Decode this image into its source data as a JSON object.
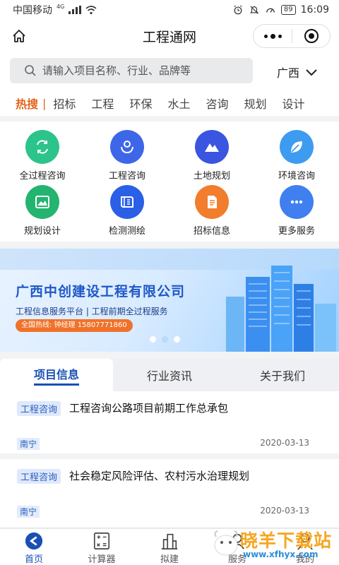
{
  "status_bar": {
    "carrier": "中国移动",
    "network": "4G",
    "battery": "89",
    "time": "16:09"
  },
  "title_bar": {
    "title": "工程通网"
  },
  "search": {
    "placeholder": "请输入项目名称、行业、品牌等",
    "region": "广西"
  },
  "hot": {
    "label": "热搜",
    "separator": "|",
    "tags": [
      "招标",
      "工程",
      "环保",
      "水土",
      "咨询",
      "规划",
      "设计"
    ]
  },
  "services": [
    {
      "label": "全过程咨询",
      "icon": "loop-arrows-icon",
      "color": "#2cc48a"
    },
    {
      "label": "工程咨询",
      "icon": "hands-person-icon",
      "color": "#3d67e8"
    },
    {
      "label": "土地规划",
      "icon": "mountain-icon",
      "color": "#3a55e0"
    },
    {
      "label": "环境咨询",
      "icon": "leaf-icon",
      "color": "#3d9bf0"
    },
    {
      "label": "规划设计",
      "icon": "landscape-frame-icon",
      "color": "#23b46f"
    },
    {
      "label": "检测测绘",
      "icon": "ruler-book-icon",
      "color": "#2b5fe6"
    },
    {
      "label": "招标信息",
      "icon": "document-icon",
      "color": "#f27d2c"
    },
    {
      "label": "更多服务",
      "icon": "more-dots-icon",
      "color": "#3f7ff0"
    }
  ],
  "banner": {
    "title": "广西中创建设工程有限公司",
    "subtitle": "工程信息服务平台 | 工程前期全过程服务",
    "hotline": "全国热线: 钟经理 15807771860",
    "slides": 3,
    "active_slide": 1
  },
  "tabs": [
    {
      "label": "项目信息",
      "active": true
    },
    {
      "label": "行业资讯",
      "active": false
    },
    {
      "label": "关于我们",
      "active": false
    }
  ],
  "projects": [
    {
      "category": "工程咨询",
      "title": "工程咨询公路项目前期工作总承包",
      "location": "南宁",
      "date": "2020-03-13"
    },
    {
      "category": "工程咨询",
      "title": "社会稳定风险评估、农村污水治理规划",
      "location": "南宁",
      "date": "2020-03-13"
    }
  ],
  "bottom_nav": [
    {
      "label": "首页",
      "icon": "home-arrow-icon",
      "active": true
    },
    {
      "label": "计算器",
      "icon": "calculator-icon",
      "active": false
    },
    {
      "label": "拟建",
      "icon": "buildings-icon",
      "active": false
    },
    {
      "label": "服务",
      "icon": "service-icon",
      "active": false
    },
    {
      "label": "我的",
      "icon": "user-icon",
      "active": false
    }
  ],
  "watermark": {
    "text": "晓羊下载站",
    "url": "www.xfhyx.com"
  },
  "colors": {
    "accent": "#1a4fb4",
    "hot": "#e0661f",
    "badge_bg": "#dfe9fb"
  }
}
